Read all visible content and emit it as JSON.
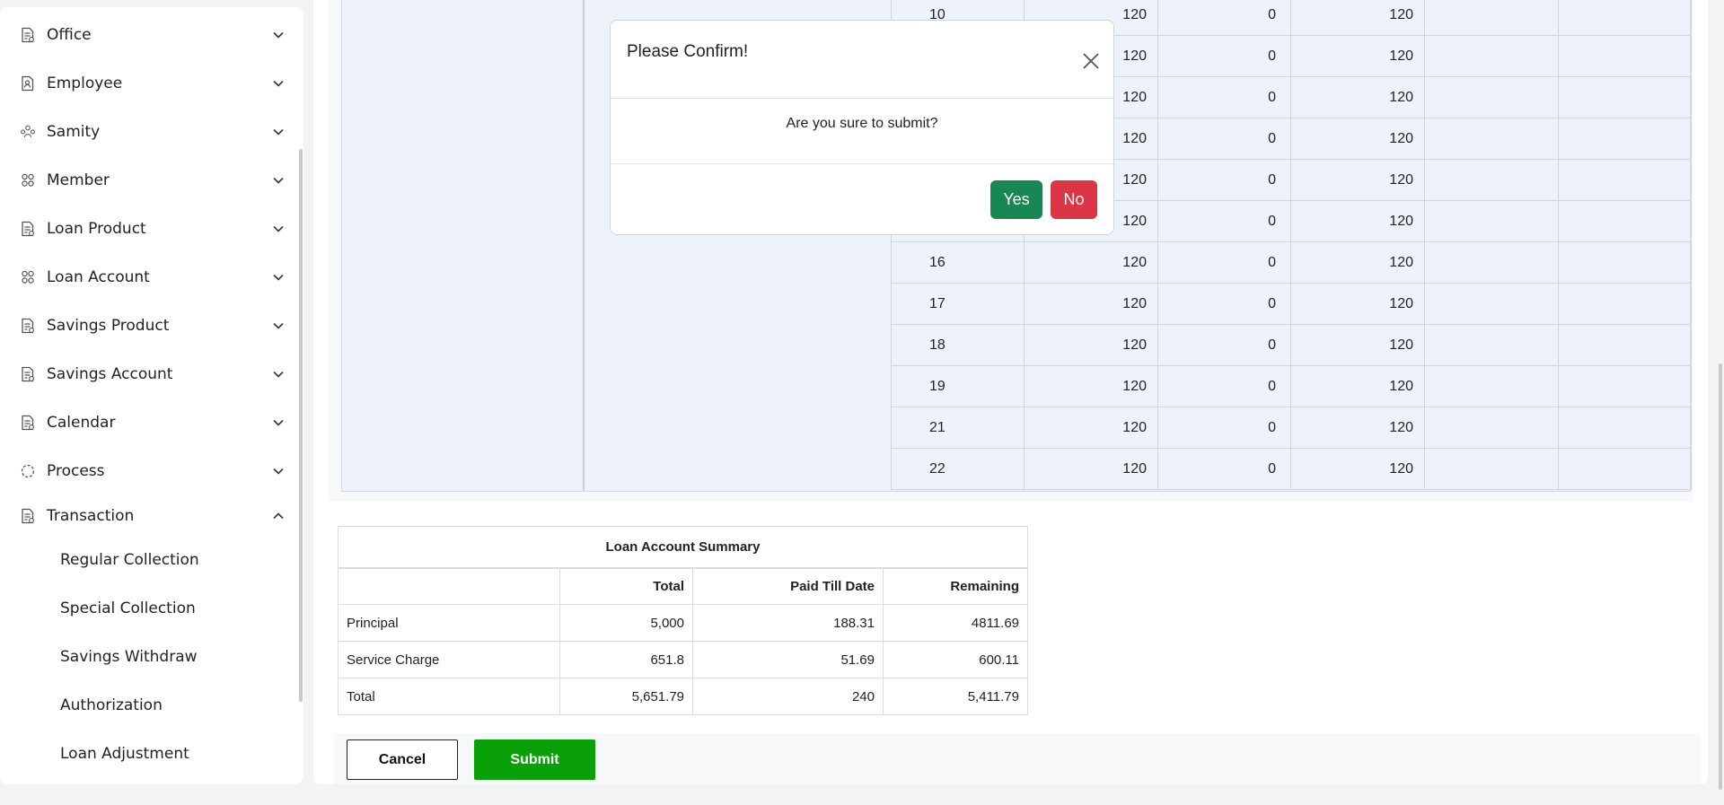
{
  "sidebar": {
    "menu": [
      {
        "label": "Office",
        "icon": "document-icon",
        "expanded": false
      },
      {
        "label": "Employee",
        "icon": "document-person-icon",
        "expanded": false
      },
      {
        "label": "Samity",
        "icon": "group-icon",
        "expanded": false
      },
      {
        "label": "Member",
        "icon": "members-icon",
        "expanded": false
      },
      {
        "label": "Loan Product",
        "icon": "document-icon",
        "expanded": false
      },
      {
        "label": "Loan Account",
        "icon": "members-icon",
        "expanded": false
      },
      {
        "label": "Savings Product",
        "icon": "document-icon",
        "expanded": false
      },
      {
        "label": "Savings Account",
        "icon": "document-icon",
        "expanded": false
      },
      {
        "label": "Calendar",
        "icon": "document-icon",
        "expanded": false
      },
      {
        "label": "Process",
        "icon": "process-icon",
        "expanded": false
      },
      {
        "label": "Transaction",
        "icon": "document-icon",
        "expanded": true
      }
    ],
    "submenu": [
      {
        "label": "Regular Collection"
      },
      {
        "label": "Special Collection"
      },
      {
        "label": "Savings Withdraw"
      },
      {
        "label": "Authorization"
      },
      {
        "label": "Loan Adjustment"
      }
    ]
  },
  "schedule": {
    "rows": [
      {
        "no": "10",
        "a": "120",
        "b": "0",
        "c": "120"
      },
      {
        "no": "",
        "a": "120",
        "b": "0",
        "c": "120"
      },
      {
        "no": "",
        "a": "120",
        "b": "0",
        "c": "120"
      },
      {
        "no": "",
        "a": "120",
        "b": "0",
        "c": "120"
      },
      {
        "no": "",
        "a": "120",
        "b": "0",
        "c": "120"
      },
      {
        "no": "",
        "a": "120",
        "b": "0",
        "c": "120"
      },
      {
        "no": "16",
        "a": "120",
        "b": "0",
        "c": "120"
      },
      {
        "no": "17",
        "a": "120",
        "b": "0",
        "c": "120"
      },
      {
        "no": "18",
        "a": "120",
        "b": "0",
        "c": "120"
      },
      {
        "no": "19",
        "a": "120",
        "b": "0",
        "c": "120"
      },
      {
        "no": "21",
        "a": "120",
        "b": "0",
        "c": "120"
      },
      {
        "no": "22",
        "a": "120",
        "b": "0",
        "c": "120"
      }
    ]
  },
  "summary": {
    "title": "Loan Account Summary",
    "headers": [
      "",
      "Total",
      "Paid Till Date",
      "Remaining"
    ],
    "rows": [
      {
        "label": "Principal",
        "total": "5,000",
        "paid": "188.31",
        "remaining": "4811.69"
      },
      {
        "label": "Service Charge",
        "total": "651.8",
        "paid": "51.69",
        "remaining": "600.11"
      },
      {
        "label": "Total",
        "total": "5,651.79",
        "paid": "240",
        "remaining": "5,411.79"
      }
    ]
  },
  "actions": {
    "cancel_label": "Cancel",
    "submit_label": "Submit"
  },
  "modal": {
    "title": "Please Confirm!",
    "message": "Are you sure to submit?",
    "yes_label": "Yes",
    "no_label": "No"
  },
  "colors": {
    "submit": "#0aa00a",
    "yes": "#198754",
    "no": "#dc3545",
    "schedule_bg": "#eef3fb"
  }
}
